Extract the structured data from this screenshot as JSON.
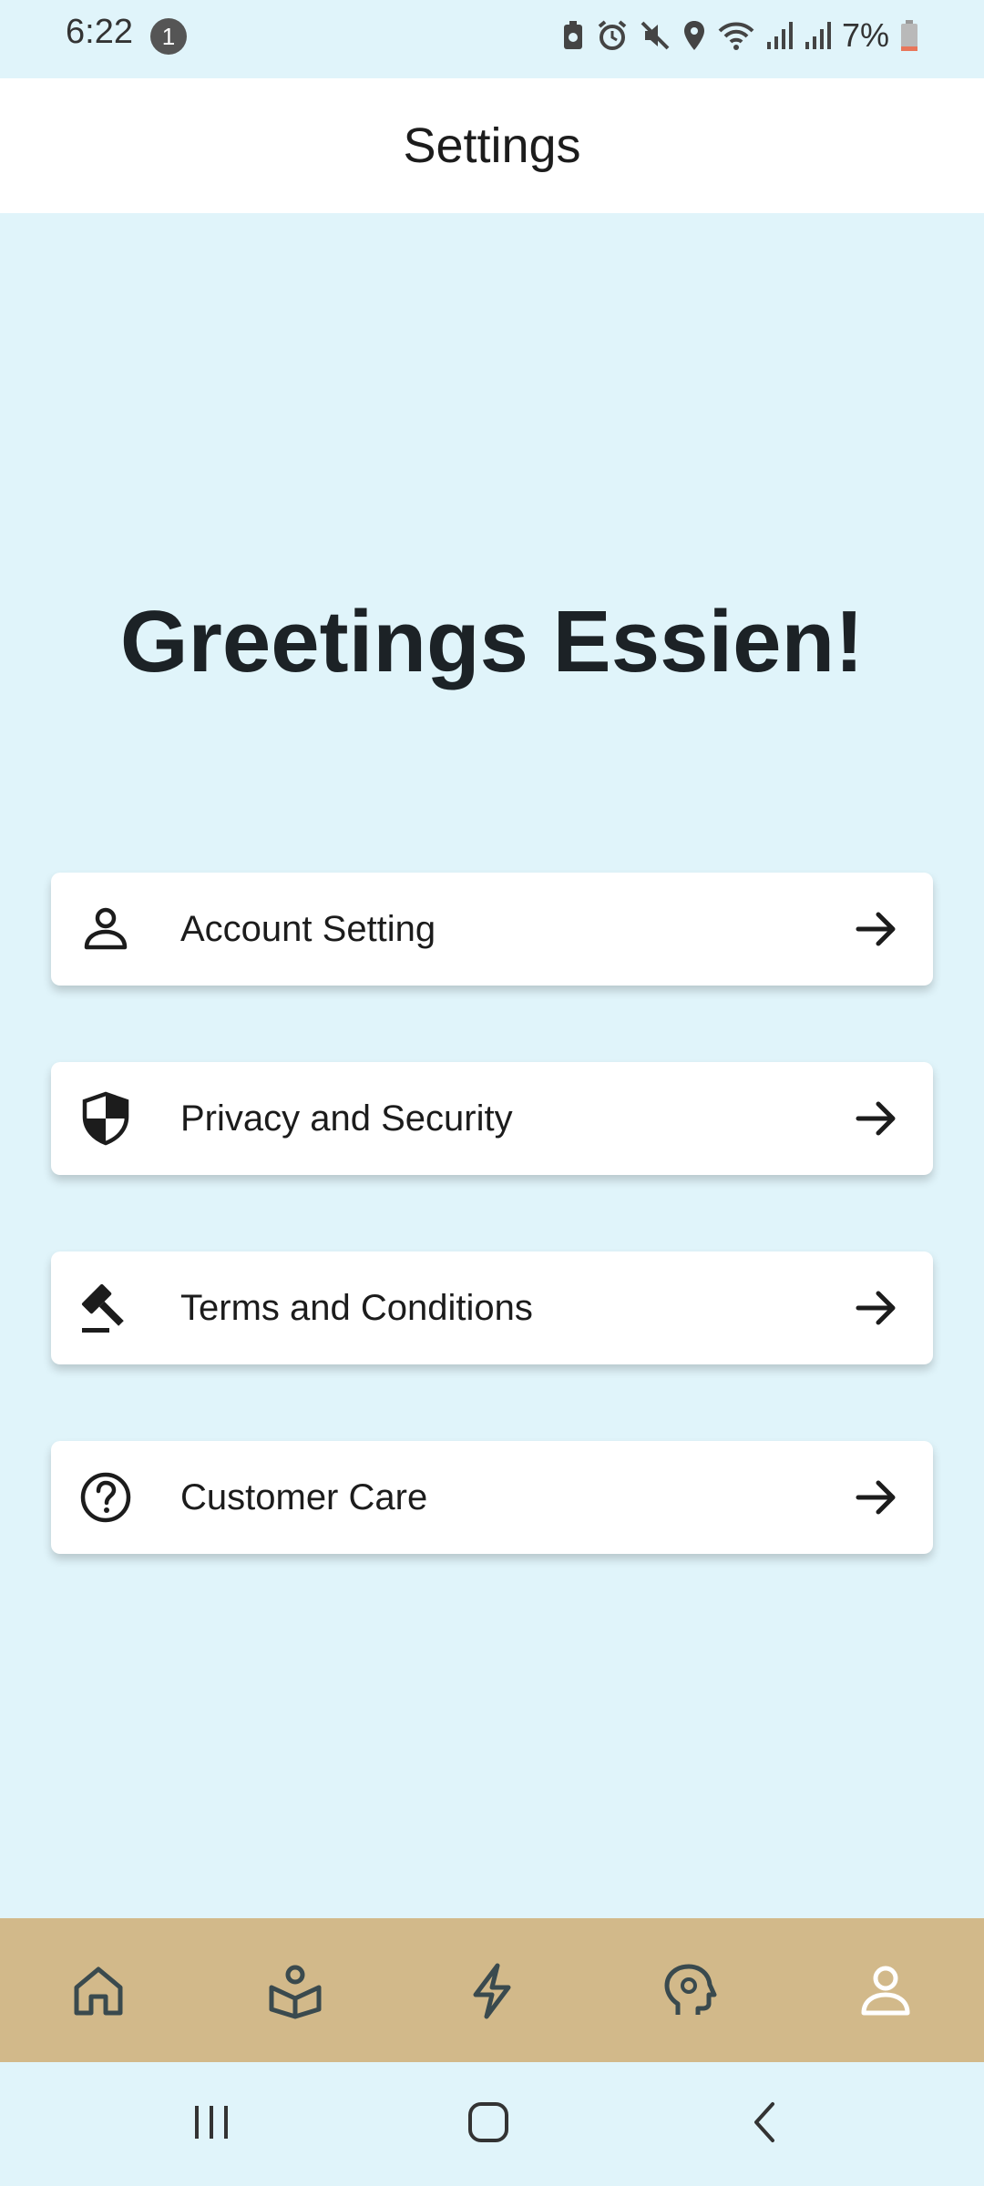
{
  "status_bar": {
    "time": "6:22",
    "notification_count": "1",
    "battery": "7%",
    "icons": [
      "battery-saver-icon",
      "alarm-icon",
      "mute-icon",
      "location-icon",
      "wifi-icon",
      "signal-icon",
      "signal-icon",
      "battery-icon"
    ]
  },
  "app_bar": {
    "title": "Settings"
  },
  "greeting": "Greetings Essien!",
  "menu": {
    "items": [
      {
        "label": "Account Setting",
        "icon": "person-icon"
      },
      {
        "label": "Privacy and Security",
        "icon": "shield-icon"
      },
      {
        "label": "Terms and Conditions",
        "icon": "gavel-icon"
      },
      {
        "label": "Customer Care",
        "icon": "help-circle-icon"
      }
    ],
    "arrow_icon": "arrow-right-icon"
  },
  "bottom_nav": {
    "items": [
      {
        "icon": "home-icon",
        "active": false
      },
      {
        "icon": "learn-icon",
        "active": false
      },
      {
        "icon": "lightning-icon",
        "active": false
      },
      {
        "icon": "mind-icon",
        "active": false
      },
      {
        "icon": "profile-icon",
        "active": true
      }
    ],
    "background": "#d2b98a",
    "active_color": "#ffffff",
    "inactive_color": "#3a4a4e"
  },
  "colors": {
    "page_background": "#e0f4fa",
    "card_background": "#ffffff",
    "text": "#1c1c1c"
  }
}
